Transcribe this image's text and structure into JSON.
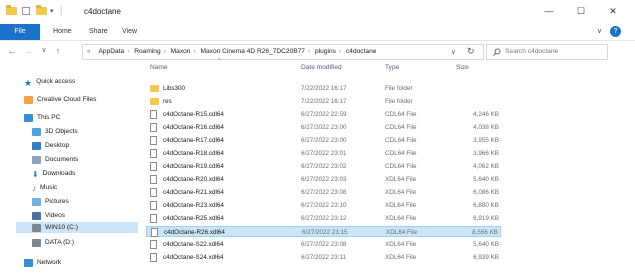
{
  "window": {
    "title": "c4doctane",
    "controls": {
      "minimize": "—",
      "maximize": "☐",
      "close": "✕"
    }
  },
  "ribbon": {
    "file": "File",
    "home": "Home",
    "share": "Share",
    "view": "View",
    "expand": "∨",
    "help": "?"
  },
  "address": {
    "back": "←",
    "forward": "→",
    "recent": "∨",
    "up": "↑",
    "prefix": "«",
    "crumbs": [
      "AppData",
      "Roaming",
      "Maxon",
      "Maxon Cinema 4D R26_7DC20B77",
      "plugins",
      "c4doctane"
    ],
    "dropdown": "∨",
    "refresh": "↻"
  },
  "search": {
    "placeholder": "Search c4doctane"
  },
  "columns": {
    "name": "Name",
    "date": "Date modified",
    "type": "Type",
    "size": "Size",
    "sort_arrow": "^"
  },
  "sidebar": {
    "items": [
      {
        "label": "Quick access"
      },
      {
        "label": "Creative Cloud Files"
      },
      {
        "label": "This PC"
      },
      {
        "label": "3D Objects"
      },
      {
        "label": "Desktop"
      },
      {
        "label": "Documents"
      },
      {
        "label": "Downloads"
      },
      {
        "label": "Music"
      },
      {
        "label": "Pictures"
      },
      {
        "label": "Videos"
      },
      {
        "label": "WIN10 (C:)"
      },
      {
        "label": "DATA (D:)"
      },
      {
        "label": "Network"
      }
    ]
  },
  "files": [
    {
      "name": "Libs300",
      "date": "7/22/2022 16:17",
      "type": "File folder",
      "size": ""
    },
    {
      "name": "res",
      "date": "7/22/2022 16:17",
      "type": "File folder",
      "size": ""
    },
    {
      "name": "c4dOctane-R15.cdl64",
      "date": "6/27/2022 22:59",
      "type": "CDL64 File",
      "size": "4,246 KB"
    },
    {
      "name": "c4dOctane-R16.cdl64",
      "date": "6/27/2022 23:00",
      "type": "CDL64 File",
      "size": "4,038 KB"
    },
    {
      "name": "c4dOctane-R17.cdl64",
      "date": "6/27/2022 23:00",
      "type": "CDL64 File",
      "size": "3,955 KB"
    },
    {
      "name": "c4dOctane-R18.cdl64",
      "date": "6/27/2022 23:01",
      "type": "CDL64 File",
      "size": "3,966 KB"
    },
    {
      "name": "c4dOctane-R19.cdl64",
      "date": "6/27/2022 23:02",
      "type": "CDL64 File",
      "size": "4,062 KB"
    },
    {
      "name": "c4dOctane-R20.xdl64",
      "date": "6/27/2022 23:03",
      "type": "XDL64 File",
      "size": "5,640 KB"
    },
    {
      "name": "c4dOctane-R21.xdl64",
      "date": "6/27/2022 23:08",
      "type": "XDL64 File",
      "size": "6,086 KB"
    },
    {
      "name": "c4dOctane-R23.xdl64",
      "date": "6/27/2022 23:10",
      "type": "XDL64 File",
      "size": "6,880 KB"
    },
    {
      "name": "c4dOctane-R25.xdl64",
      "date": "6/27/2022 23:12",
      "type": "XDL64 File",
      "size": "6,919 KB"
    },
    {
      "name": "c4dOctane-R26.xdl64",
      "date": "6/27/2022 23:15",
      "type": "XDL64 File",
      "size": "8,556 KB"
    },
    {
      "name": "c4dOctane-S22.xdl64",
      "date": "6/27/2022 23:08",
      "type": "XDL64 File",
      "size": "5,640 KB"
    },
    {
      "name": "c4dOctane-S24.xdl64",
      "date": "6/27/2022 23:11",
      "type": "XDL64 File",
      "size": "6,939 KB"
    }
  ]
}
